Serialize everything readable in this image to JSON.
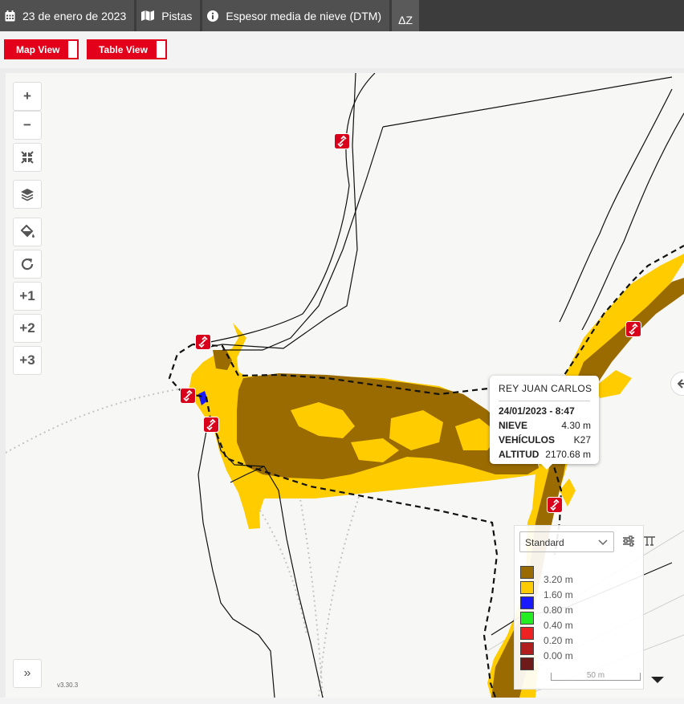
{
  "toolbar": {
    "date_label": "23 de enero de 2023",
    "pistas_label": "Pistas",
    "layer_label": "Espesor media de nieve (DTM)",
    "delta_label": "ΔZ"
  },
  "views": {
    "map_view_label": "Map View",
    "table_view_label": "Table View"
  },
  "map_controls": {
    "zoom_in": "+",
    "zoom_out": "−",
    "plus1": "+1",
    "plus2": "+2",
    "plus3": "+3",
    "expand": "»"
  },
  "popup": {
    "title": "REY JUAN CARLOS",
    "datetime": "24/01/2023 - 8:47",
    "rows": [
      {
        "label": "NIEVE",
        "value": "4.30 m"
      },
      {
        "label": "VEHÍCULOS",
        "value": "K27"
      },
      {
        "label": "ALTITUD",
        "value": "2170.68 m"
      }
    ]
  },
  "legend": {
    "selected_style": "Standard",
    "items": [
      {
        "label": "3.20 m",
        "color": "#9a6b00"
      },
      {
        "label": "1.60 m",
        "color": "#ffcc00"
      },
      {
        "label": "0.80 m",
        "color": "#1a1aff"
      },
      {
        "label": "0.40 m",
        "color": "#22ee22"
      },
      {
        "label": "0.20 m",
        "color": "#ee2222"
      },
      {
        "label": "0.00 m",
        "color": "#b21e1e"
      },
      {
        "label": "",
        "color": "#6e1a1a"
      }
    ],
    "scale_label": "50 m"
  },
  "version": "v3.30.3",
  "colors": {
    "accent": "#e2001a",
    "snow_deep": "#9a6b00",
    "snow_mid": "#ffcc00"
  }
}
